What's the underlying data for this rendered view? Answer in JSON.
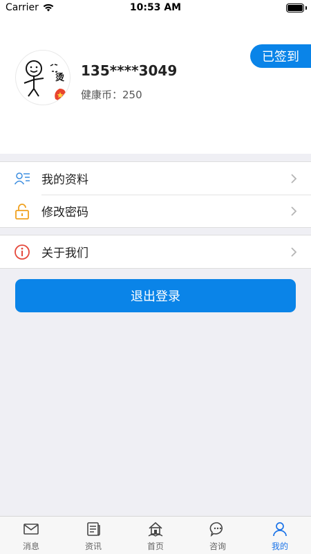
{
  "status_bar": {
    "carrier": "Carrier",
    "time": "10:53 AM"
  },
  "profile": {
    "phone": "135****3049",
    "coins_label": "健康币：",
    "coins_value": "250",
    "checkin_label": "已签到"
  },
  "menu": {
    "group1": [
      {
        "label": "我的资料",
        "icon": "user-card-icon"
      },
      {
        "label": "修改密码",
        "icon": "unlock-icon"
      }
    ],
    "group2": [
      {
        "label": "关于我们",
        "icon": "info-icon"
      }
    ]
  },
  "logout_label": "退出登录",
  "tabs": [
    {
      "label": "消息",
      "icon": "mail-icon",
      "active": false
    },
    {
      "label": "资讯",
      "icon": "news-icon",
      "active": false
    },
    {
      "label": "首页",
      "icon": "home-icon",
      "active": false
    },
    {
      "label": "咨询",
      "icon": "chat-icon",
      "active": false
    },
    {
      "label": "我的",
      "icon": "person-icon",
      "active": true
    }
  ],
  "colors": {
    "accent": "#0a84e8",
    "background": "#efeff4",
    "active_tab": "#1a73e8"
  }
}
